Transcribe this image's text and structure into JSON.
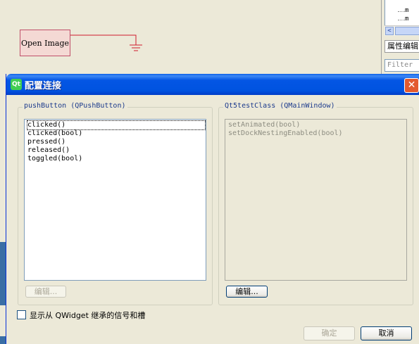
{
  "canvas": {
    "open_image_button": "Open Image"
  },
  "right_panel": {
    "tree_items": [
      "m",
      "m"
    ],
    "scroll_left_arrow": "<",
    "property_editor_title": "属性编辑",
    "filter_placeholder": "Filter"
  },
  "dialog": {
    "title": "配置连接",
    "close_label": "✕",
    "left_group": {
      "title": "pushButton (QPushButton)",
      "items": [
        "clicked()",
        "clicked(bool)",
        "pressed()",
        "released()",
        "toggled(bool)"
      ],
      "selected_index": 0,
      "edit_button": "编辑..."
    },
    "right_group": {
      "title": "Qt5testClass (QMainWindow)",
      "items": [
        "setAnimated(bool)",
        "setDockNestingEnabled(bool)"
      ],
      "edit_button": "编辑..."
    },
    "show_inherited_checkbox": "显示从 QWidget 继承的信号和槽",
    "ok_button": "确定",
    "cancel_button": "取消"
  },
  "colors": {
    "titlebar": "#0053e0",
    "dialog_bg": "#ece9d8",
    "group_title": "#1b3a8c",
    "close_button": "#e35a2e"
  }
}
